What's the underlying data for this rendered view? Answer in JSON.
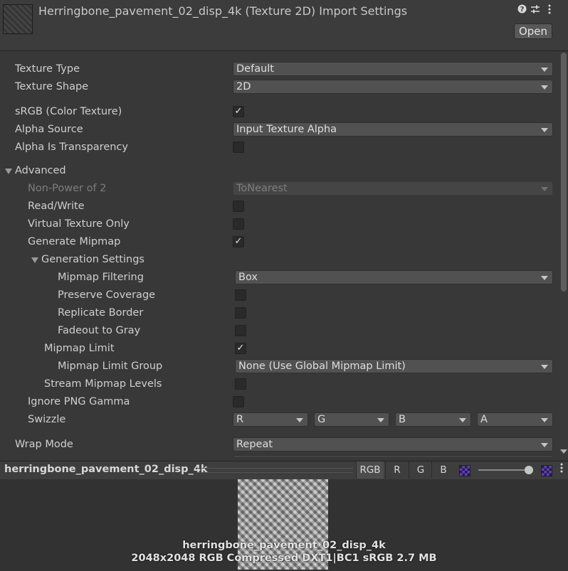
{
  "header": {
    "title": "Herringbone_pavement_02_disp_4k (Texture 2D) Import Settings",
    "open_label": "Open",
    "icons": [
      "help-icon",
      "preset-sliders-icon",
      "kebab-menu-icon"
    ]
  },
  "settings": {
    "texture_type": {
      "label": "Texture Type",
      "value": "Default"
    },
    "texture_shape": {
      "label": "Texture Shape",
      "value": "2D"
    },
    "srgb": {
      "label": "sRGB (Color Texture)",
      "checked": true
    },
    "alpha_source": {
      "label": "Alpha Source",
      "value": "Input Texture Alpha"
    },
    "alpha_is_transparency": {
      "label": "Alpha Is Transparency",
      "checked": false
    },
    "advanced": {
      "label": "Advanced",
      "expanded": true
    },
    "non_power_of_2": {
      "label": "Non-Power of 2",
      "value": "ToNearest",
      "disabled": true
    },
    "read_write": {
      "label": "Read/Write",
      "checked": false
    },
    "virtual_texture_only": {
      "label": "Virtual Texture Only",
      "checked": false
    },
    "generate_mipmap": {
      "label": "Generate Mipmap",
      "checked": true
    },
    "generation_settings": {
      "label": "Generation Settings",
      "expanded": true
    },
    "mipmap_filtering": {
      "label": "Mipmap Filtering",
      "value": "Box"
    },
    "preserve_coverage": {
      "label": "Preserve Coverage",
      "checked": false
    },
    "replicate_border": {
      "label": "Replicate Border",
      "checked": false
    },
    "fadeout_to_gray": {
      "label": "Fadeout to Gray",
      "checked": false
    },
    "mipmap_limit": {
      "label": "Mipmap Limit",
      "checked": true
    },
    "mipmap_limit_group": {
      "label": "Mipmap Limit Group",
      "value": "None (Use Global Mipmap Limit)"
    },
    "stream_mipmap_levels": {
      "label": "Stream Mipmap Levels",
      "checked": false
    },
    "ignore_png_gamma": {
      "label": "Ignore PNG Gamma",
      "checked": false
    },
    "swizzle": {
      "label": "Swizzle",
      "values": [
        "R",
        "G",
        "B",
        "A"
      ]
    },
    "wrap_mode": {
      "label": "Wrap Mode",
      "value": "Repeat"
    }
  },
  "check_glyph": "✓",
  "preview": {
    "name": "herringbone_pavement_02_disp_4k",
    "channels": [
      "RGB",
      "R",
      "G",
      "B"
    ],
    "active_channel": "RGB",
    "info_name": "herringbone_pavement_02_disp_4k",
    "info_details": "2048x2048  RGB Compressed DXT1|BC1 sRGB  2.7 MB"
  },
  "colors": {
    "background": "#383838",
    "header": "#3c3c3c",
    "dropdown": "#515151",
    "checkbox": "#2a2a2a"
  }
}
